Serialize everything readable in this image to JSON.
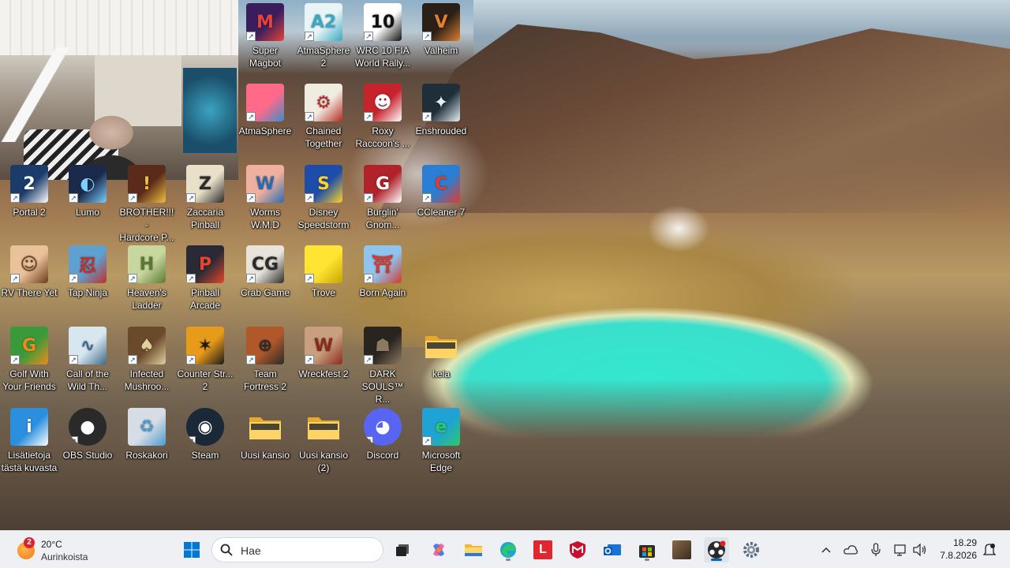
{
  "desktop": {
    "icons": [
      {
        "label": "Super\nMagbot",
        "icon": "super-magbot-icon"
      },
      {
        "label": "AtmaSphere\n2",
        "icon": "atmasphere2-icon"
      },
      {
        "label": "WRC 10 FIA\nWorld Rally...",
        "icon": "wrc10-icon"
      },
      {
        "label": "Valheim",
        "icon": "valheim-icon"
      },
      {
        "label": "AtmaSphere",
        "icon": "atmasphere-icon"
      },
      {
        "label": "Chained\nTogether",
        "icon": "chained-together-icon"
      },
      {
        "label": "Roxy\nRaccoon's ...",
        "icon": "roxy-raccoon-icon"
      },
      {
        "label": "Enshrouded",
        "icon": "enshrouded-icon"
      },
      {
        "label": "Portal 2",
        "icon": "portal2-icon"
      },
      {
        "label": "Lumo",
        "icon": "lumo-icon"
      },
      {
        "label": "BROTHER!!! -\nHardcore P...",
        "icon": "brother-icon"
      },
      {
        "label": "Zaccaria\nPinball",
        "icon": "zaccaria-pinball-icon"
      },
      {
        "label": "Worms\nW.M.D",
        "icon": "worms-wmd-icon"
      },
      {
        "label": "Disney\nSpeedstorm",
        "icon": "disney-speedstorm-icon"
      },
      {
        "label": "Burglin'\nGnom...",
        "icon": "burglin-gnomes-icon"
      },
      {
        "label": "CCleaner 7",
        "icon": "ccleaner-icon"
      },
      {
        "label": "RV There Yet",
        "icon": "rv-there-yet-icon"
      },
      {
        "label": "Tap Ninja",
        "icon": "tap-ninja-icon"
      },
      {
        "label": "Heaven's\nLadder",
        "icon": "heavens-ladder-icon"
      },
      {
        "label": "Pinball\nArcade",
        "icon": "pinball-arcade-icon"
      },
      {
        "label": "Crab Game",
        "icon": "crab-game-icon"
      },
      {
        "label": "Trove",
        "icon": "trove-icon"
      },
      {
        "label": "Born Again",
        "icon": "born-again-icon"
      },
      {
        "label": "Golf With\nYour Friends",
        "icon": "golf-with-friends-icon"
      },
      {
        "label": "Call of the\nWild Th...",
        "icon": "call-of-the-wild-icon"
      },
      {
        "label": "Infected\nMushroo...",
        "icon": "infected-mushroom-icon"
      },
      {
        "label": "Counter Str...\n2",
        "icon": "counter-strike2-icon"
      },
      {
        "label": "Team\nFortress 2",
        "icon": "team-fortress2-icon"
      },
      {
        "label": "Wreckfest 2",
        "icon": "wreckfest2-icon"
      },
      {
        "label": "DARK\nSOULS™ R...",
        "icon": "dark-souls-icon"
      },
      {
        "label": "kela",
        "icon": "folder-icon"
      },
      {
        "label": "Lisätietoja\ntästä kuvasta",
        "icon": "spotlight-info-icon"
      },
      {
        "label": "OBS Studio",
        "icon": "obs-studio-icon"
      },
      {
        "label": "Roskakori",
        "icon": "recycle-bin-icon"
      },
      {
        "label": "Steam",
        "icon": "steam-icon"
      },
      {
        "label": "Uusi kansio",
        "icon": "folder-icon"
      },
      {
        "label": "Uusi kansio\n(2)",
        "icon": "folder-icon"
      },
      {
        "label": "Discord",
        "icon": "discord-icon"
      },
      {
        "label": "Microsoft\nEdge",
        "icon": "edge-icon"
      }
    ]
  },
  "taskbar": {
    "weather": {
      "badge": "2",
      "temp": "20°C",
      "desc": "Aurinkoista"
    },
    "search": {
      "placeholder": "Hae"
    },
    "l_app": "L",
    "clock": {
      "time": "18.29",
      "date": "7.8.2026"
    }
  },
  "colors": {
    "taskbar_bg": "#eef0f4",
    "lake": "#35e6cf",
    "accent": "#0067c0"
  }
}
